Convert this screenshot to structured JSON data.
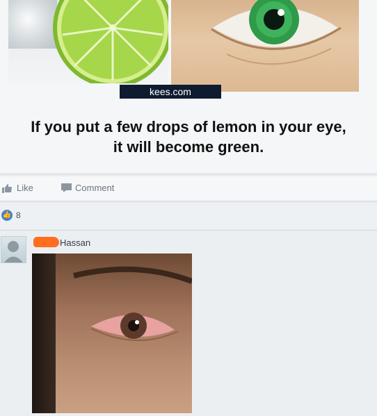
{
  "post": {
    "watermark": "kees.com",
    "caption_line1": "If you put a few drops of lemon in your eye,",
    "caption_line2": "it will become green.",
    "colors": {
      "lime": "#8fc93a",
      "iris": "#2e9a4a",
      "watermark_bg": "#0f1b2f"
    }
  },
  "actions": {
    "like_label": "Like",
    "comment_label": "Comment"
  },
  "reactions": {
    "count": "8"
  },
  "comment": {
    "author": "Hassan",
    "redaction_color": "#ff6d1f"
  }
}
